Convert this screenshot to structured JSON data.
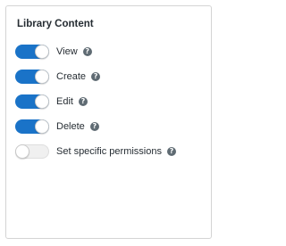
{
  "panel": {
    "title": "Library Content"
  },
  "permissions": [
    {
      "label": "View",
      "enabled": true
    },
    {
      "label": "Create",
      "enabled": true
    },
    {
      "label": "Edit",
      "enabled": true
    },
    {
      "label": "Delete",
      "enabled": true
    },
    {
      "label": "Set specific permissions",
      "enabled": false
    }
  ],
  "help_icon_glyph": "?",
  "colors": {
    "toggle_on": "#1a73c8",
    "toggle_off": "#f0f0f0",
    "text": "#262d33",
    "help_icon": "#5f6b73"
  }
}
